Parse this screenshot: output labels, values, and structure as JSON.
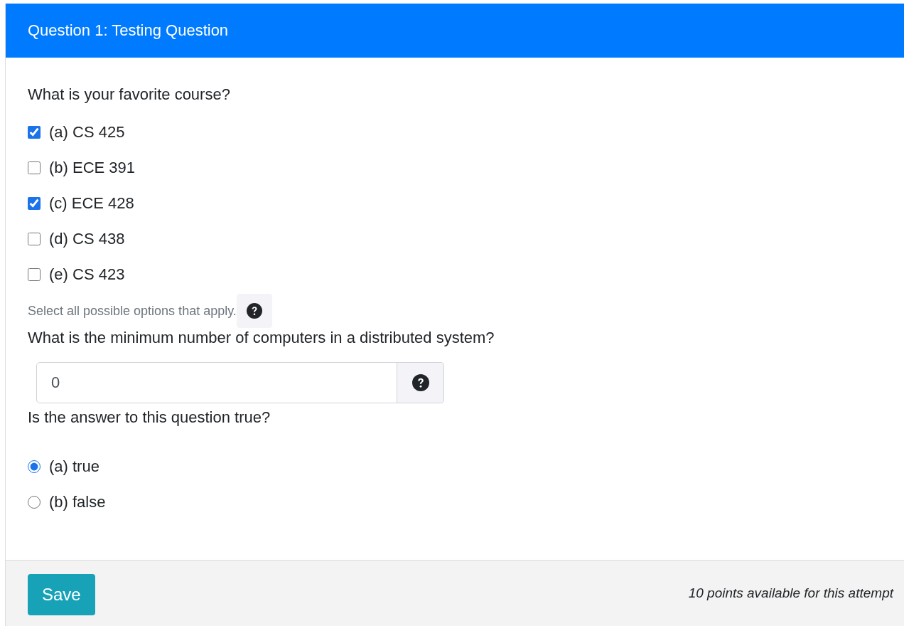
{
  "header": {
    "title": "Question 1: Testing Question"
  },
  "questions": [
    {
      "kind": "checkbox",
      "prompt": "What is your favorite course?",
      "options": [
        {
          "label": "(a) CS 425",
          "checked": true
        },
        {
          "label": "(b) ECE 391",
          "checked": false
        },
        {
          "label": "(c) ECE 428",
          "checked": true
        },
        {
          "label": "(d) CS 438",
          "checked": false
        },
        {
          "label": "(e) CS 423",
          "checked": false
        }
      ],
      "help_text": "Select all possible options that apply."
    },
    {
      "kind": "number",
      "prompt": "What is the minimum number of computers in a distributed system?",
      "value": "0"
    },
    {
      "kind": "radio",
      "prompt": "Is the answer to this question true?",
      "options": [
        {
          "label": "(a) true",
          "selected": true
        },
        {
          "label": "(b) false",
          "selected": false
        }
      ]
    }
  ],
  "footer": {
    "button": "Save",
    "note": "10 points available for this attempt"
  }
}
